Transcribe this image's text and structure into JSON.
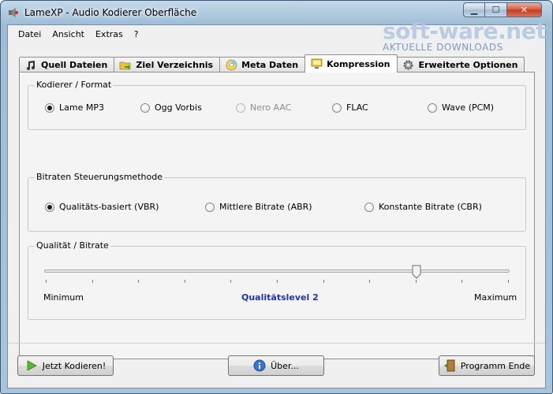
{
  "window": {
    "title": "LameXP - Audio Kodierer Oberfläche"
  },
  "watermark": {
    "brand": "soft-ware.net",
    "tagline": "AKTUELLE DOWNLOADS"
  },
  "menu": {
    "items": [
      "Datei",
      "Ansicht",
      "Extras",
      "?"
    ]
  },
  "tabs": [
    {
      "label": "Quell Dateien",
      "icon": "music-note-icon"
    },
    {
      "label": "Ziel Verzeichnis",
      "icon": "folder-arrow-icon"
    },
    {
      "label": "Meta Daten",
      "icon": "cd-icon"
    },
    {
      "label": "Kompression",
      "icon": "monitor-icon",
      "active": true
    },
    {
      "label": "Erweiterte Optionen",
      "icon": "gear-icon"
    }
  ],
  "encoder": {
    "title": "Kodierer / Format",
    "options": [
      {
        "label": "Lame MP3",
        "checked": true,
        "disabled": false
      },
      {
        "label": "Ogg Vorbis",
        "checked": false,
        "disabled": false
      },
      {
        "label": "Nero AAC",
        "checked": false,
        "disabled": true
      },
      {
        "label": "FLAC",
        "checked": false,
        "disabled": false
      },
      {
        "label": "Wave (PCM)",
        "checked": false,
        "disabled": false
      }
    ]
  },
  "bitrate": {
    "title": "Bitraten Steuerungsmethode",
    "options": [
      {
        "label": "Qualitäts-basiert (VBR)",
        "checked": true
      },
      {
        "label": "Mittlere Bitrate (ABR)",
        "checked": false
      },
      {
        "label": "Konstante Bitrate (CBR)",
        "checked": false
      }
    ]
  },
  "quality": {
    "title": "Qualität / Bitrate",
    "min_label": "Minimum",
    "max_label": "Maximum",
    "level_label": "Qualitätslevel 2",
    "slider_fraction": 0.8
  },
  "buttons": {
    "encode": "Jetzt Kodieren!",
    "about": "Über...",
    "exit": "Programm Ende"
  }
}
